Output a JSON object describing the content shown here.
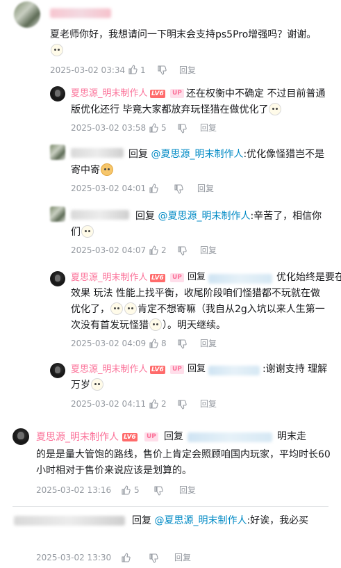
{
  "comments": [
    {
      "text": "夏老师你好，我想请问一下明末会支持ps5Pro增强吗？谢谢。",
      "time": "2025-03-02 03:34",
      "likes": "1",
      "reply_label": "回复"
    },
    {
      "username": "夏思源_明末制作人",
      "level": "LV6",
      "badge": "UP",
      "text": "还在权衡中不确定 不过目前普通版优化还行 毕竟大家都放弃玩怪猎在做优化了",
      "time": "2025-03-02 03:58",
      "likes": "5",
      "reply_label": "回复"
    },
    {
      "reply_prefix": "回复",
      "mention": "@夏思源_明末制作人",
      "text": ":优化像怪猎岂不是寄中寄",
      "time": "2025-03-02 04:01",
      "reply_label": "回复"
    },
    {
      "reply_prefix": "回复",
      "mention": "@夏思源_明末制作人",
      "text": ":辛苦了，相信你们",
      "time": "2025-03-02 04:07",
      "likes": "2",
      "reply_label": "回复"
    },
    {
      "username": "夏思源_明末制作人",
      "level": "LV6",
      "badge": "UP",
      "reply_prefix": "回复",
      "text_tail": "优化始终是要在",
      "text": "效果 玩法 性能上找平衡，收尾阶段咱们怪猎都不玩就在做优化了，",
      "text2": "肯定不想寄嘛（我自从2g入坑以来人生第一次没有首发玩怪猎",
      "text3": "）。明天继续。",
      "time": "2025-03-02 04:09",
      "likes": "8",
      "reply_label": "回复"
    },
    {
      "username": "夏思源_明末制作人",
      "level": "LV6",
      "badge": "UP",
      "reply_prefix": "回复",
      "text": ":谢谢支持 理解万岁",
      "time": "2025-03-02 04:11",
      "likes": "2",
      "reply_label": "回复"
    },
    {
      "username": "夏思源_明末制作人",
      "level": "LV6",
      "badge": "UP",
      "reply_prefix": "回复",
      "text_tail": "明末走",
      "text": "的是是量大管饱的路线，售价上肯定会照顾咱国内玩家，平均时长60小时相对于售价来说应该是划算的。",
      "time": "2025-03-02 13:16",
      "likes": "5",
      "reply_label": "回复"
    },
    {
      "reply_prefix": "回复",
      "mention": "@夏思源_明末制作人",
      "text": ":好诶，我必买",
      "time": "2025-03-02 13:30",
      "reply_label": "回复"
    }
  ],
  "icons": {
    "like": "thumb-up-icon",
    "dislike": "thumb-down-icon"
  },
  "colors": {
    "username": "#fb7299",
    "mention": "#008ac5",
    "meta": "#9499a0",
    "level_badge": "#ff6b6b"
  }
}
